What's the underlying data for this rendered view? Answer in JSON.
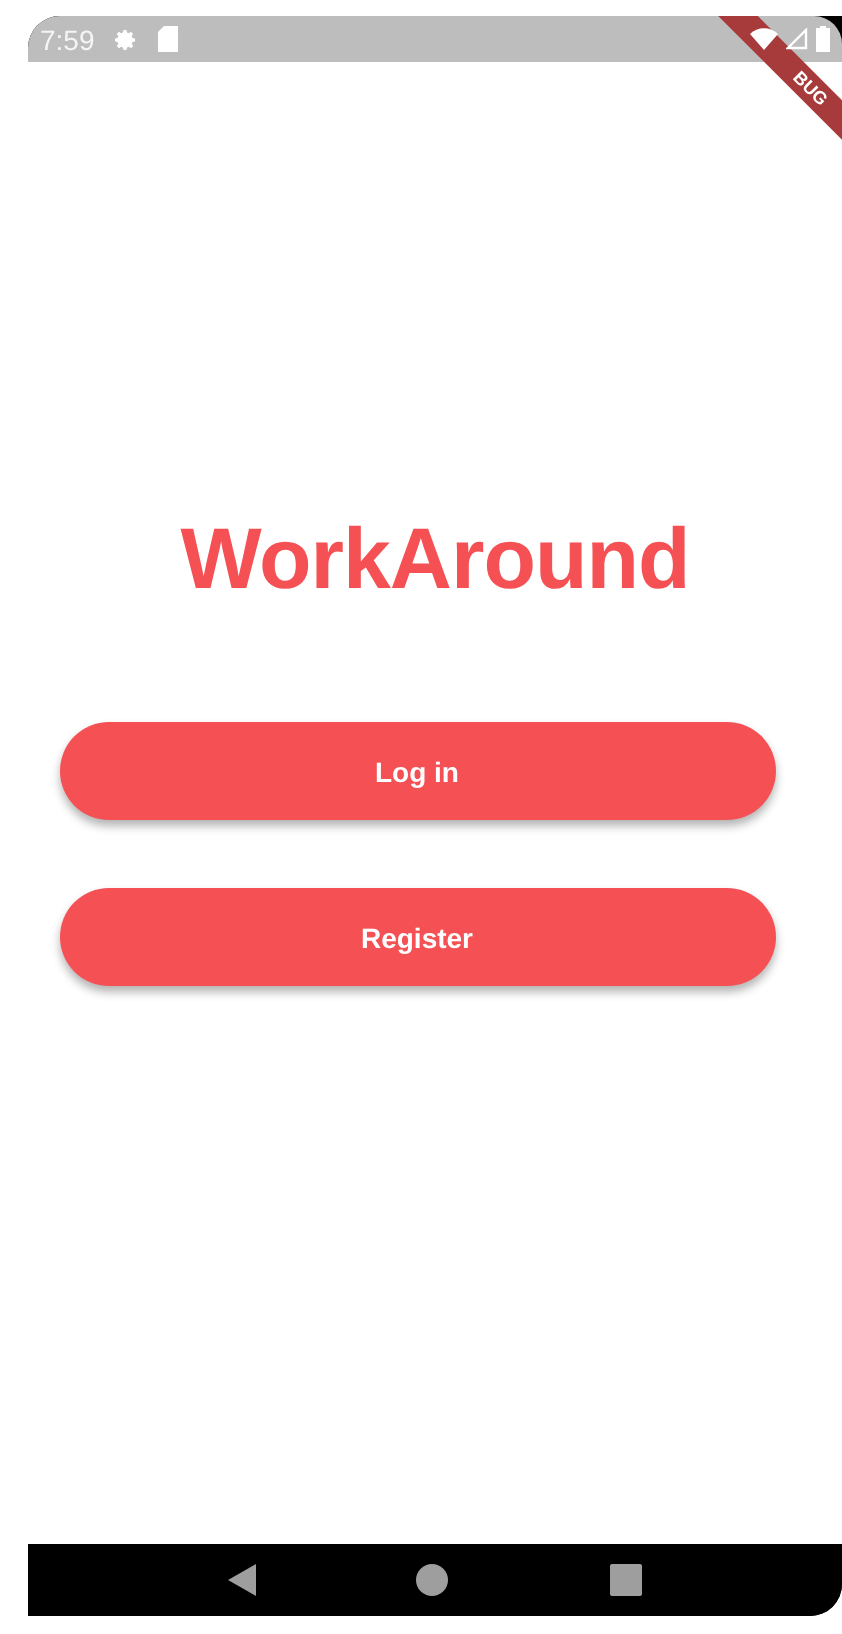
{
  "status_bar": {
    "time": "7:59"
  },
  "debug_banner": {
    "label": "BUG"
  },
  "app": {
    "title": "WorkAround"
  },
  "buttons": [
    {
      "label": "Log in"
    },
    {
      "label": "Register"
    }
  ]
}
